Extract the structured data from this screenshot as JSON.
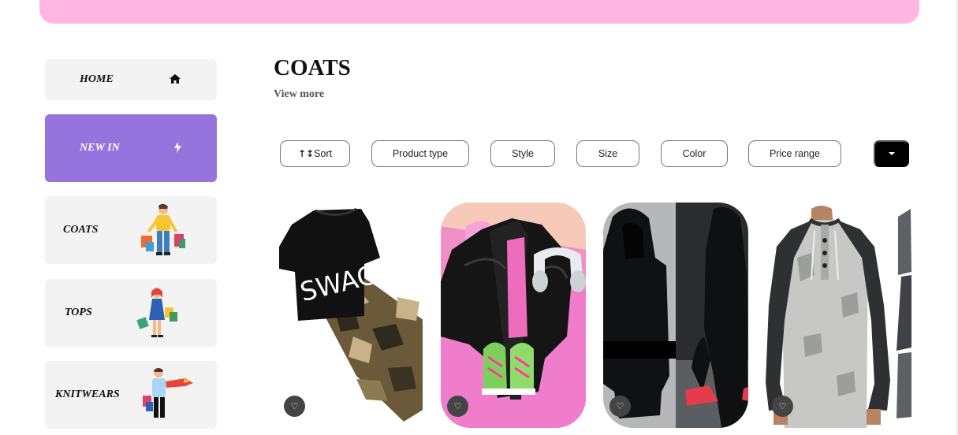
{
  "sidebar": {
    "items": [
      {
        "label": "HOME",
        "icon": "home-icon"
      },
      {
        "label": "NEW IN",
        "icon": "lightning-icon",
        "active": true
      },
      {
        "label": "COATS",
        "icon": "shopper-man-illustration"
      },
      {
        "label": "TOPS",
        "icon": "shopper-woman-illustration"
      },
      {
        "label": "KNITWEARS",
        "icon": "shopper-scarf-illustration"
      }
    ]
  },
  "main": {
    "title": "COATS",
    "view_more": "View more",
    "filters": [
      "Sort",
      "Product type",
      "Style",
      "Size",
      "Color",
      "Price range"
    ],
    "dropdown_icon": "caret-down-icon"
  },
  "products": [
    {
      "image": "swag-tshirt-camo-pants",
      "shirt_text": "SWAG"
    },
    {
      "image": "black-jacket-pink-flatlay"
    },
    {
      "image": "black-hoodie-red-sneakers"
    },
    {
      "image": "grey-raglan-henley"
    }
  ],
  "colors": {
    "banner": "#ffb6e0",
    "active": "#9575dd",
    "sidebar_bg": "#f3f3f3"
  }
}
